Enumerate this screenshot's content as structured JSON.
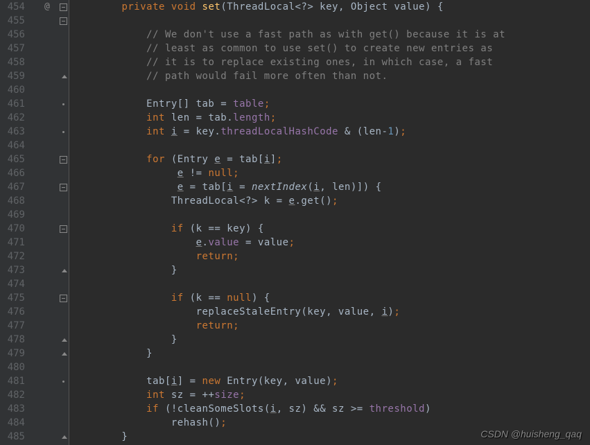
{
  "line_start": 454,
  "line_end": 485,
  "bookmark_symbol": "@",
  "watermark": "CSDN @huisheng_qaq",
  "fold_markers": [
    {
      "line": 454,
      "type": "minus"
    },
    {
      "line": 455,
      "type": "minus"
    },
    {
      "line": 459,
      "type": "arrow"
    },
    {
      "line": 461,
      "type": "dot"
    },
    {
      "line": 463,
      "type": "dot"
    },
    {
      "line": 465,
      "type": "minus"
    },
    {
      "line": 467,
      "type": "minus"
    },
    {
      "line": 470,
      "type": "minus"
    },
    {
      "line": 473,
      "type": "arrow"
    },
    {
      "line": 475,
      "type": "minus"
    },
    {
      "line": 478,
      "type": "arrow"
    },
    {
      "line": 479,
      "type": "arrow"
    },
    {
      "line": 481,
      "type": "dot"
    },
    {
      "line": 485,
      "type": "arrow"
    }
  ],
  "code_lines": [
    {
      "n": 454,
      "segs": [
        {
          "t": "        ",
          "c": ""
        },
        {
          "t": "private void ",
          "c": "kw"
        },
        {
          "t": "set",
          "c": "mname"
        },
        {
          "t": "(ThreadLocal<?> key, Object value) {",
          "c": ""
        }
      ]
    },
    {
      "n": 455,
      "segs": []
    },
    {
      "n": 456,
      "segs": [
        {
          "t": "            ",
          "c": ""
        },
        {
          "t": "// We don't use a fast path as with get() because it is at",
          "c": "comment"
        }
      ]
    },
    {
      "n": 457,
      "segs": [
        {
          "t": "            ",
          "c": ""
        },
        {
          "t": "// least as common to use set() to create new entries as",
          "c": "comment"
        }
      ]
    },
    {
      "n": 458,
      "segs": [
        {
          "t": "            ",
          "c": ""
        },
        {
          "t": "// it is to replace existing ones, in which case, a fast",
          "c": "comment"
        }
      ]
    },
    {
      "n": 459,
      "segs": [
        {
          "t": "            ",
          "c": ""
        },
        {
          "t": "// path would fail more often than not.",
          "c": "comment"
        }
      ]
    },
    {
      "n": 460,
      "segs": []
    },
    {
      "n": 461,
      "segs": [
        {
          "t": "            Entry[] tab = ",
          "c": ""
        },
        {
          "t": "table",
          "c": "field"
        },
        {
          "t": ";",
          "c": "kw"
        }
      ]
    },
    {
      "n": 462,
      "segs": [
        {
          "t": "            ",
          "c": ""
        },
        {
          "t": "int ",
          "c": "kw"
        },
        {
          "t": "len = tab.",
          "c": ""
        },
        {
          "t": "length",
          "c": "field"
        },
        {
          "t": ";",
          "c": "kw"
        }
      ]
    },
    {
      "n": 463,
      "segs": [
        {
          "t": "            ",
          "c": ""
        },
        {
          "t": "int ",
          "c": "kw"
        },
        {
          "t": "i",
          "c": "underline"
        },
        {
          "t": " = key.",
          "c": ""
        },
        {
          "t": "threadLocalHashCode",
          "c": "field"
        },
        {
          "t": " & (len-",
          "c": ""
        },
        {
          "t": "1",
          "c": "num"
        },
        {
          "t": ")",
          "c": ""
        },
        {
          "t": ";",
          "c": "kw"
        }
      ]
    },
    {
      "n": 464,
      "segs": []
    },
    {
      "n": 465,
      "segs": [
        {
          "t": "            ",
          "c": ""
        },
        {
          "t": "for ",
          "c": "kw"
        },
        {
          "t": "(Entry ",
          "c": ""
        },
        {
          "t": "e",
          "c": "underline"
        },
        {
          "t": " = tab[",
          "c": ""
        },
        {
          "t": "i",
          "c": "underline"
        },
        {
          "t": "]",
          "c": ""
        },
        {
          "t": ";",
          "c": "kw"
        }
      ]
    },
    {
      "n": 466,
      "segs": [
        {
          "t": "                 ",
          "c": ""
        },
        {
          "t": "e",
          "c": "underline"
        },
        {
          "t": " != ",
          "c": ""
        },
        {
          "t": "null",
          "c": "kw"
        },
        {
          "t": ";",
          "c": "kw"
        }
      ]
    },
    {
      "n": 467,
      "segs": [
        {
          "t": "                 ",
          "c": ""
        },
        {
          "t": "e",
          "c": "underline"
        },
        {
          "t": " = tab[",
          "c": ""
        },
        {
          "t": "i",
          "c": "underline"
        },
        {
          "t": " = ",
          "c": ""
        },
        {
          "t": "nextIndex",
          "c": "italic"
        },
        {
          "t": "(",
          "c": ""
        },
        {
          "t": "i",
          "c": "underline"
        },
        {
          "t": ", len)]) {",
          "c": ""
        }
      ]
    },
    {
      "n": 468,
      "segs": [
        {
          "t": "                ThreadLocal<?> k = ",
          "c": ""
        },
        {
          "t": "e",
          "c": "underline"
        },
        {
          "t": ".get()",
          "c": ""
        },
        {
          "t": ";",
          "c": "kw"
        }
      ]
    },
    {
      "n": 469,
      "segs": []
    },
    {
      "n": 470,
      "segs": [
        {
          "t": "                ",
          "c": ""
        },
        {
          "t": "if ",
          "c": "kw"
        },
        {
          "t": "(k == key) {",
          "c": ""
        }
      ]
    },
    {
      "n": 471,
      "segs": [
        {
          "t": "                    ",
          "c": ""
        },
        {
          "t": "e",
          "c": "underline"
        },
        {
          "t": ".",
          "c": ""
        },
        {
          "t": "value",
          "c": "field"
        },
        {
          "t": " = value",
          "c": ""
        },
        {
          "t": ";",
          "c": "kw"
        }
      ]
    },
    {
      "n": 472,
      "segs": [
        {
          "t": "                    ",
          "c": ""
        },
        {
          "t": "return;",
          "c": "kw"
        }
      ]
    },
    {
      "n": 473,
      "segs": [
        {
          "t": "                }",
          "c": ""
        }
      ]
    },
    {
      "n": 474,
      "segs": []
    },
    {
      "n": 475,
      "segs": [
        {
          "t": "                ",
          "c": ""
        },
        {
          "t": "if ",
          "c": "kw"
        },
        {
          "t": "(k == ",
          "c": ""
        },
        {
          "t": "null",
          "c": "kw"
        },
        {
          "t": ") {",
          "c": ""
        }
      ]
    },
    {
      "n": 476,
      "segs": [
        {
          "t": "                    replaceStaleEntry(key, value, ",
          "c": ""
        },
        {
          "t": "i",
          "c": "underline"
        },
        {
          "t": ")",
          "c": ""
        },
        {
          "t": ";",
          "c": "kw"
        }
      ]
    },
    {
      "n": 477,
      "segs": [
        {
          "t": "                    ",
          "c": ""
        },
        {
          "t": "return;",
          "c": "kw"
        }
      ]
    },
    {
      "n": 478,
      "segs": [
        {
          "t": "                }",
          "c": ""
        }
      ]
    },
    {
      "n": 479,
      "segs": [
        {
          "t": "            }",
          "c": ""
        }
      ]
    },
    {
      "n": 480,
      "segs": []
    },
    {
      "n": 481,
      "segs": [
        {
          "t": "            tab[",
          "c": ""
        },
        {
          "t": "i",
          "c": "underline"
        },
        {
          "t": "] = ",
          "c": ""
        },
        {
          "t": "new ",
          "c": "kw"
        },
        {
          "t": "Entry(key, value)",
          "c": ""
        },
        {
          "t": ";",
          "c": "kw"
        }
      ]
    },
    {
      "n": 482,
      "segs": [
        {
          "t": "            ",
          "c": ""
        },
        {
          "t": "int ",
          "c": "kw"
        },
        {
          "t": "sz = ++",
          "c": ""
        },
        {
          "t": "size",
          "c": "field"
        },
        {
          "t": ";",
          "c": "kw"
        }
      ]
    },
    {
      "n": 483,
      "segs": [
        {
          "t": "            ",
          "c": ""
        },
        {
          "t": "if ",
          "c": "kw"
        },
        {
          "t": "(!cleanSomeSlots(",
          "c": ""
        },
        {
          "t": "i",
          "c": "underline"
        },
        {
          "t": ", sz) && sz >= ",
          "c": ""
        },
        {
          "t": "threshold",
          "c": "field"
        },
        {
          "t": ")",
          "c": ""
        }
      ]
    },
    {
      "n": 484,
      "segs": [
        {
          "t": "                rehash()",
          "c": ""
        },
        {
          "t": ";",
          "c": "kw"
        }
      ]
    },
    {
      "n": 485,
      "segs": [
        {
          "t": "        }",
          "c": ""
        }
      ]
    }
  ]
}
